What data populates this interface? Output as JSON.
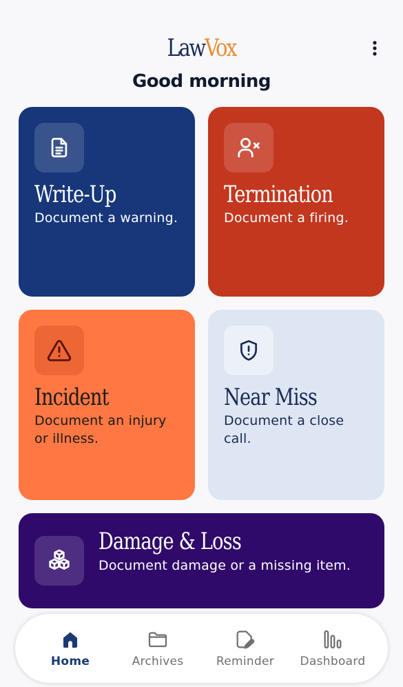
{
  "header": {
    "brand_part1": "Law",
    "brand_part2": "Vox",
    "greeting": "Good morning",
    "menu_icon": "more-vertical-icon"
  },
  "cards": [
    {
      "title": "Write-Up",
      "description": "Document a warning.",
      "icon": "document-icon",
      "bg": "#17377a",
      "fg": "#ffffff"
    },
    {
      "title": "Termination",
      "description": "Document a firing.",
      "icon": "user-remove-icon",
      "bg": "#c3371f",
      "fg": "#ffffff"
    },
    {
      "title": "Incident",
      "description": "Document an injury or illness.",
      "icon": "warning-triangle-icon",
      "bg": "#ff7843",
      "fg": "#1a1a1a"
    },
    {
      "title": "Near Miss",
      "description": "Document a close call.",
      "icon": "shield-alert-icon",
      "bg": "#dde6f2",
      "fg": "#1a2a55"
    },
    {
      "title": "Damage & Loss",
      "description": "Document damage or a missing item.",
      "icon": "cubes-icon",
      "bg": "#2f0a6a",
      "fg": "#ffffff"
    }
  ],
  "nav": {
    "items": [
      {
        "label": "Home",
        "icon": "home-icon",
        "active": true
      },
      {
        "label": "Archives",
        "icon": "folder-icon",
        "active": false
      },
      {
        "label": "Reminder",
        "icon": "note-edit-icon",
        "active": false
      },
      {
        "label": "Dashboard",
        "icon": "bar-chart-icon",
        "active": false
      }
    ]
  },
  "colors": {
    "background": "#f8f8fa",
    "brand_navy": "#1a2a55",
    "brand_orange": "#e98d36",
    "nav_active": "#1a3a72",
    "nav_inactive": "#6f6f74"
  }
}
